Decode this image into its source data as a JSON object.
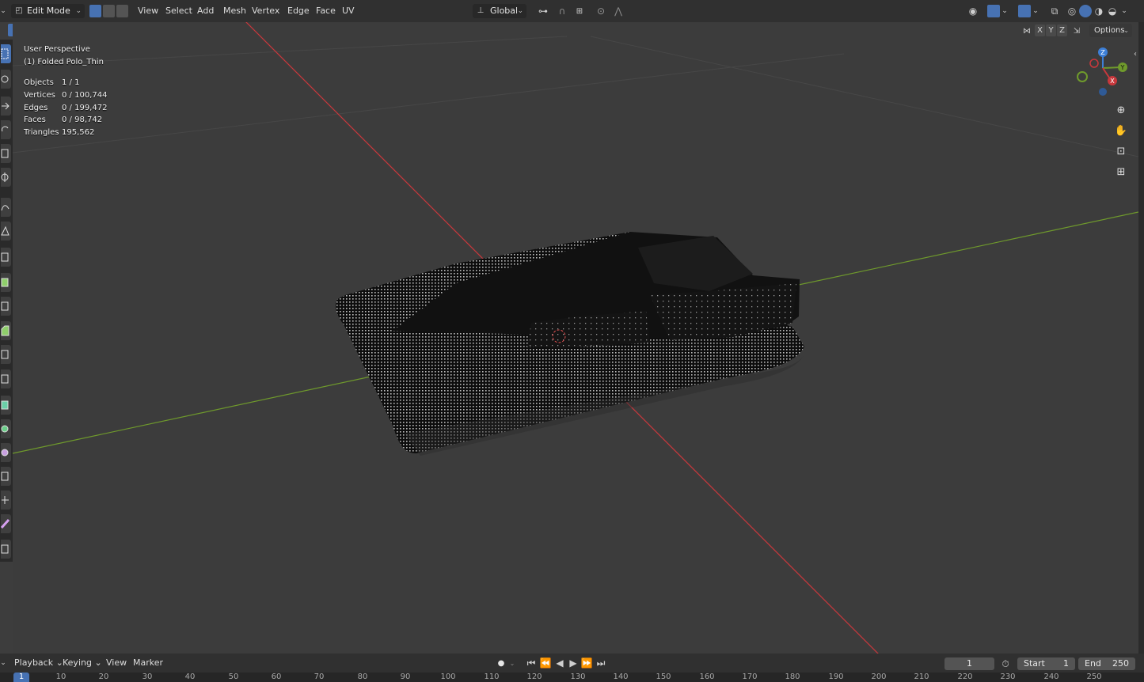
{
  "header": {
    "mode": "Edit Mode",
    "menus": [
      "View",
      "Select",
      "Add",
      "Mesh",
      "Vertex",
      "Edge",
      "Face",
      "UV"
    ],
    "orientation": "Global",
    "options_label": "Options",
    "axis_x": "X",
    "axis_y": "Y",
    "axis_z": "Z"
  },
  "overlay": {
    "view_name": "User Perspective",
    "object_name": "(1) Folded Polo_Thin",
    "stats": [
      {
        "label": "Objects",
        "value": "1 / 1"
      },
      {
        "label": "Vertices",
        "value": "0 / 100,744"
      },
      {
        "label": "Edges",
        "value": "0 / 199,472"
      },
      {
        "label": "Faces",
        "value": "0 / 98,742"
      },
      {
        "label": "Triangles",
        "value": "195,562"
      }
    ]
  },
  "gizmo": {
    "x": "X",
    "y": "Y",
    "z": "Z"
  },
  "timeline": {
    "menus": [
      "Playback",
      "Keying",
      "View",
      "Marker"
    ],
    "current_frame": "1",
    "start_label": "Start",
    "start_value": "1",
    "end_label": "End",
    "end_value": "250",
    "ruler_current": "1",
    "ruler_ticks": [
      "10",
      "20",
      "30",
      "40",
      "50",
      "60",
      "70",
      "80",
      "90",
      "100",
      "110",
      "120",
      "130",
      "140",
      "150",
      "160",
      "170",
      "180",
      "190",
      "200",
      "210",
      "220",
      "230",
      "240",
      "250"
    ]
  },
  "colors": {
    "x_axis": "#c9383c",
    "y_axis": "#6f9a2c",
    "z_axis": "#3d7fd6",
    "accent": "#4772b3",
    "background": "#3c3c3c"
  }
}
